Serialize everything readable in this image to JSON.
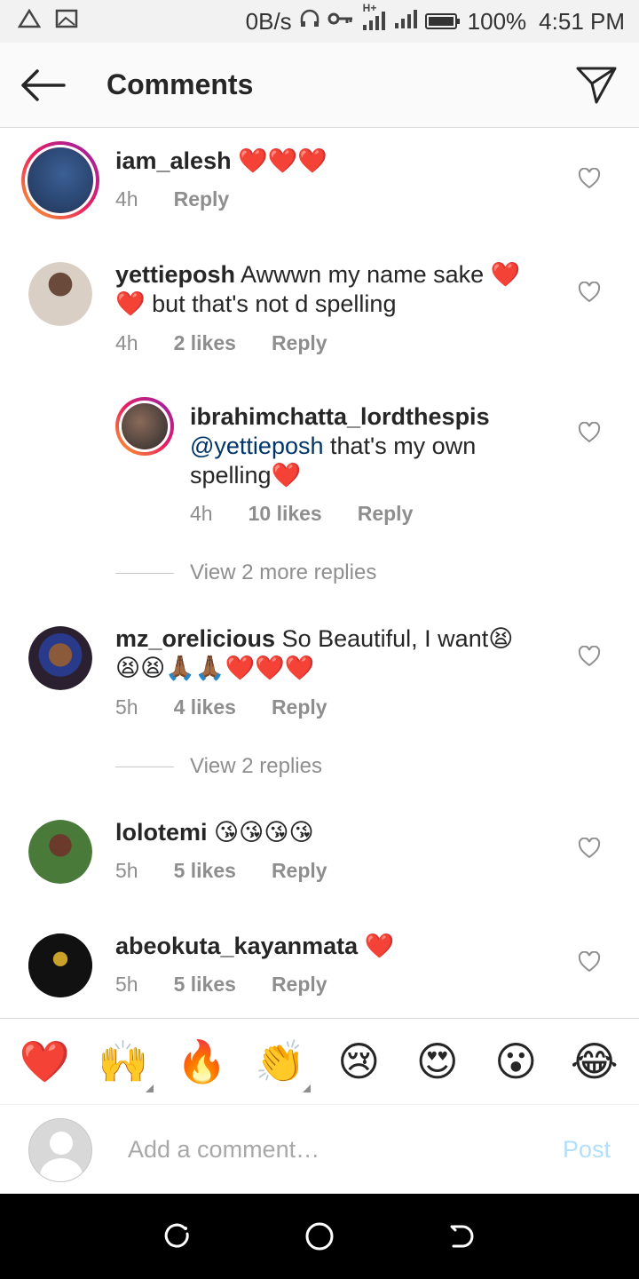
{
  "status_bar": {
    "net_speed": "0B/s",
    "network": "H+",
    "battery": "100%",
    "time": "4:51 PM"
  },
  "header": {
    "title": "Comments"
  },
  "comments": [
    {
      "username": "iam_alesh",
      "text": "❤️❤️❤️",
      "time": "4h",
      "likes": "",
      "reply_label": "Reply",
      "avatar_color": "#2a4a7a"
    },
    {
      "username": "yettieposh",
      "text": "Awwwn my name sake ❤️ ❤️ but that's not d spelling",
      "time": "4h",
      "likes": "2 likes",
      "reply_label": "Reply",
      "avatar_color": "#c9b9a8"
    },
    {
      "username": "ibrahimchatta_lordthespis",
      "mention": "@yettieposh",
      "text": " that's my own spelling❤️",
      "time": "4h",
      "likes": "10 likes",
      "reply_label": "Reply",
      "avatar_color": "#6b4a3a"
    },
    {
      "username": "mz_orelicious",
      "text": "So Beautiful,  I want😫😫😫🙏🏾🙏🏾❤️❤️❤️",
      "time": "5h",
      "likes": "4 likes",
      "reply_label": "Reply",
      "avatar_color": "#3a2a4a"
    },
    {
      "username": "lolotemi",
      "text": "😘😘😘😘",
      "time": "5h",
      "likes": "5 likes",
      "reply_label": "Reply",
      "avatar_color": "#5a7a3a"
    },
    {
      "username": "abeokuta_kayanmata",
      "text": "❤️",
      "time": "5h",
      "likes": "5 likes",
      "reply_label": "Reply",
      "avatar_color": "#111111"
    }
  ],
  "view_replies": [
    "View 2 more replies",
    "View 2 replies"
  ],
  "emoji_bar": [
    "❤️",
    "🙌",
    "🔥",
    "👏",
    "😢",
    "😍",
    "😮",
    "😂"
  ],
  "composer": {
    "placeholder": "Add a comment…",
    "post_label": "Post"
  }
}
